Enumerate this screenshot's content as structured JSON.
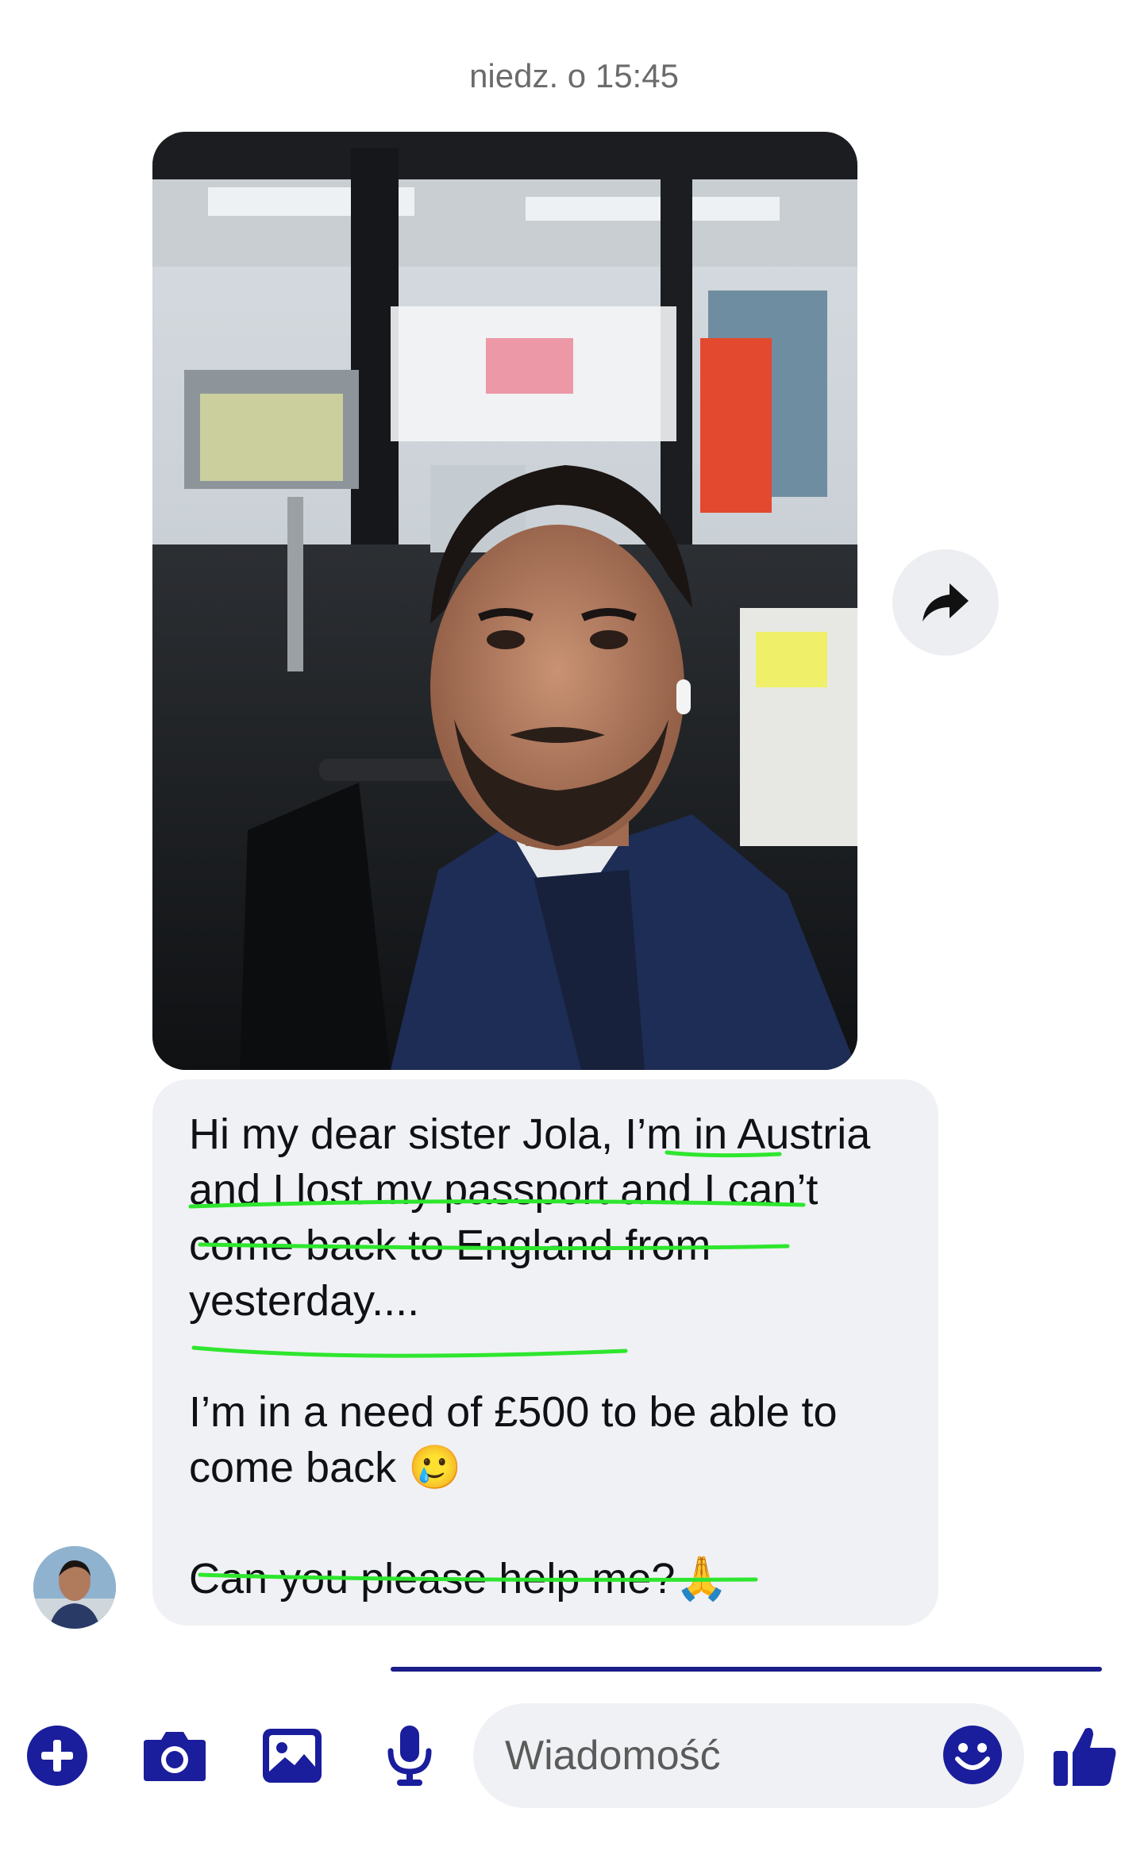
{
  "header": {
    "timestamp": "niedz. o 15:45"
  },
  "message": {
    "paragraph_1": "Hi my dear sister Jola, I’m in Austria and I lost my passport and I can’t come back to England from yesterday....",
    "paragraph_2": "I’m in a need of £500 to be able to come back 🥲",
    "paragraph_3": "Can you please help me?🙏"
  },
  "composer": {
    "placeholder": "Wiadomość"
  },
  "colors": {
    "accent": "#1a1d9c",
    "bubble": "#f0f1f4",
    "highlight_underline": "#2ee62e"
  },
  "icons": {
    "share": "share-arrow-icon",
    "add": "plus-circle-icon",
    "camera": "camera-icon",
    "gallery": "image-icon",
    "voice": "microphone-icon",
    "emoji": "smiley-icon",
    "like": "thumbs-up-icon"
  }
}
